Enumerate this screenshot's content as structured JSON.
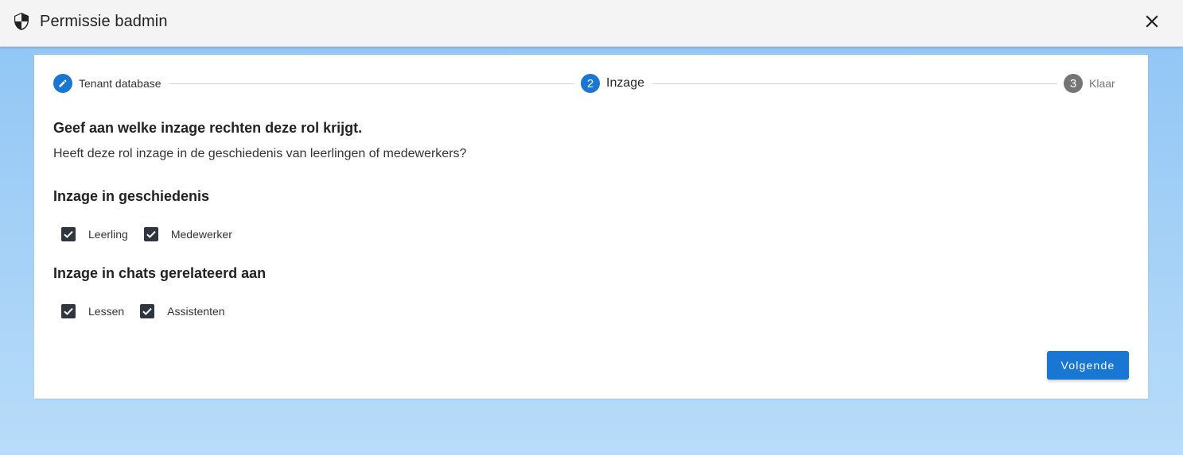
{
  "toolbar": {
    "title": "Permissie badmin",
    "icons": {
      "left": "shield-icon",
      "right": "close-icon"
    }
  },
  "stepper": {
    "steps": [
      {
        "number": "1",
        "label": "Tenant database",
        "state": "completed",
        "icon": "pencil-icon"
      },
      {
        "number": "2",
        "label": "Inzage",
        "state": "active"
      },
      {
        "number": "3",
        "label": "Klaar",
        "state": "upcoming"
      }
    ]
  },
  "content": {
    "heading": "Geef aan welke inzage rechten deze rol krijgt.",
    "subtext": "Heeft deze rol inzage in de geschiedenis van leerlingen of medewerkers?",
    "sections": [
      {
        "title": "Inzage in geschiedenis",
        "options": [
          {
            "label": "Leerling",
            "checked": true
          },
          {
            "label": "Medewerker",
            "checked": true
          }
        ]
      },
      {
        "title": "Inzage in chats gerelateerd aan",
        "options": [
          {
            "label": "Lessen",
            "checked": true
          },
          {
            "label": "Assistenten",
            "checked": true
          }
        ]
      }
    ]
  },
  "actions": {
    "next_label": "Volgende"
  },
  "colors": {
    "primary": "#1976d2",
    "checkbox": "#2f3640",
    "step_inactive": "#757575",
    "background_top": "#8ec4f4",
    "background_bottom": "#b8dcf9"
  }
}
